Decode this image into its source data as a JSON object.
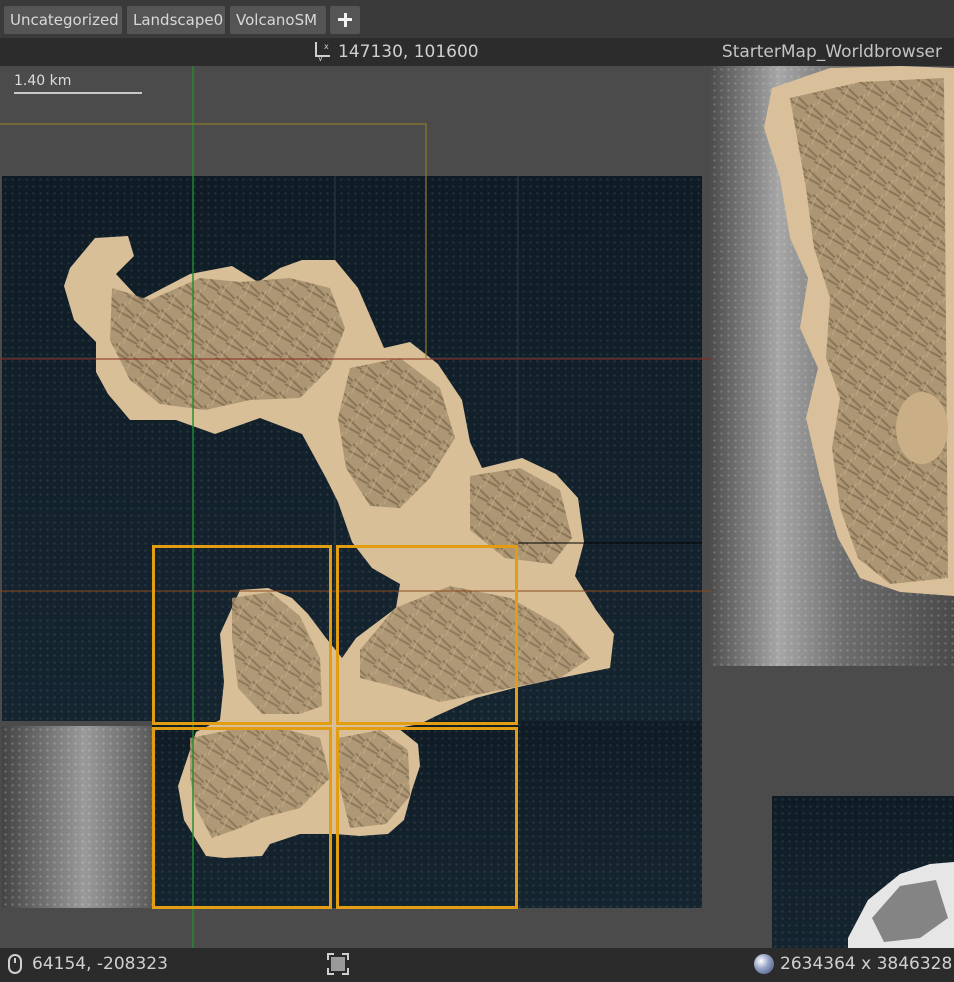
{
  "tabs": [
    {
      "label": "Uncategorized"
    },
    {
      "label": "Landscape0"
    },
    {
      "label": "VolcanoSM"
    }
  ],
  "add_tab_icon": "plus-icon",
  "viewport": {
    "cursor_coordinates": "147130, 101600",
    "axis_icon": "xy-axis-icon",
    "world_name": "StarterMap_Worldbrowser",
    "scale_label": "1.40 km"
  },
  "status": {
    "mouse_icon": "mouse-icon",
    "mouse_coordinates": "64154, -208323",
    "fit_icon": "zoom-to-fit-icon",
    "globe_icon": "globe-icon",
    "world_size": "2634364 x 3846328"
  },
  "colors": {
    "selection": "#e39d12",
    "sand": "#d9bf98",
    "rock": "#8c7658",
    "water": "#12202a",
    "x_axis": "#8b2a1e",
    "y_axis": "#1f8d2a"
  }
}
